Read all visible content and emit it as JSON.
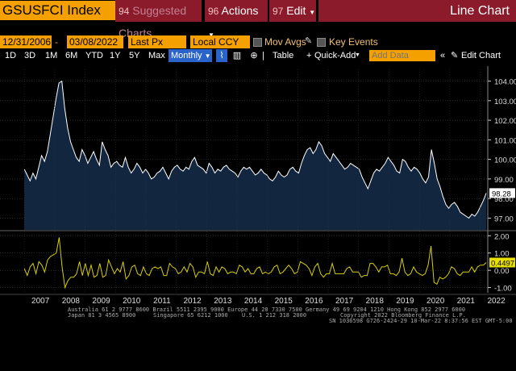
{
  "header": {
    "ticker": "GSUSFCI Index",
    "suggested": {
      "num": "94",
      "label": "Suggested Charts"
    },
    "actions": {
      "num": "96",
      "label": "Actions"
    },
    "edit": {
      "num": "97",
      "label": "Edit"
    },
    "chart_type": "Line Chart"
  },
  "settings": {
    "start_date": "12/31/2006",
    "end_date": "03/08/2022",
    "price_field": "Last Px",
    "currency": "Local CCY",
    "mov_avgs": "Mov Avgs",
    "key_events": "Key Events"
  },
  "toolbar": {
    "periods": [
      "1D",
      "3D",
      "1M",
      "6M",
      "YTD",
      "1Y",
      "5Y",
      "Max"
    ],
    "frequency": "Monthly",
    "table": "Table",
    "quick_add": "Quick-Add",
    "add_data_placeholder": "Add Data",
    "edit_chart": "Edit Chart"
  },
  "chart_data": [
    {
      "type": "area",
      "series": [
        {
          "name": "GSUSFCI Index",
          "x_start": 2007.0,
          "x_end": 2022.2,
          "values": [
            99.5,
            99.2,
            98.9,
            99.3,
            99.0,
            99.6,
            100.2,
            99.9,
            100.4,
            101.3,
            102.2,
            103.1,
            103.9,
            104.0,
            102.6,
            101.6,
            100.9,
            100.5,
            100.1,
            99.9,
            100.5,
            100.2,
            99.8,
            100.1,
            100.4,
            100.0,
            99.7,
            100.9,
            100.5,
            100.2,
            99.6,
            99.8,
            99.9,
            99.7,
            99.6,
            100.1,
            99.6,
            99.3,
            99.5,
            99.8,
            99.6,
            99.3,
            99.5,
            99.3,
            99.0,
            99.1,
            99.3,
            99.4,
            99.6,
            99.3,
            99.0,
            99.4,
            99.6,
            99.7,
            99.5,
            99.4,
            99.6,
            99.5,
            99.9,
            100.1,
            99.7,
            99.6,
            99.5,
            99.3,
            99.8,
            99.6,
            99.3,
            99.5,
            99.4,
            99.6,
            99.7,
            99.5,
            99.4,
            99.3,
            99.1,
            99.4,
            99.6,
            99.5,
            99.6,
            99.4,
            99.2,
            99.3,
            99.5,
            99.3,
            99.2,
            99.0,
            98.9,
            99.1,
            99.4,
            99.2,
            99.1,
            99.2,
            99.5,
            99.6,
            99.4,
            99.3,
            99.8,
            100.2,
            100.5,
            100.6,
            100.3,
            100.5,
            100.9,
            100.7,
            100.3,
            100.1,
            99.9,
            100.3,
            100.1,
            99.9,
            99.7,
            99.5,
            99.6,
            99.8,
            99.7,
            99.6,
            99.5,
            99.1,
            98.8,
            98.5,
            98.9,
            99.3,
            99.5,
            99.4,
            99.6,
            99.8,
            100.1,
            99.9,
            99.7,
            99.4,
            99.3,
            100.0,
            99.9,
            99.6,
            99.4,
            99.6,
            99.5,
            99.3,
            99.0,
            98.8,
            99.1,
            100.5,
            99.8,
            99.0,
            98.6,
            98.1,
            97.7,
            97.5,
            97.7,
            97.8,
            97.6,
            97.3,
            97.2,
            97.1,
            97.0,
            97.2,
            97.1,
            97.3,
            97.6,
            97.9,
            98.28
          ]
        }
      ],
      "ylim": [
        96.4,
        104.6
      ],
      "y_ticks": [
        "104.00",
        "103.00",
        "102.00",
        "101.00",
        "100.00",
        "99.00",
        "98.00",
        "97.00"
      ],
      "last_value": "98.28"
    },
    {
      "type": "line",
      "series": [
        {
          "name": "GSUSFCI Index change",
          "x_start": 2007.0,
          "x_end": 2022.2,
          "values": [
            0.1,
            -0.3,
            0.2,
            0.4,
            -0.2,
            0.5,
            0.3,
            -0.1,
            0.6,
            0.8,
            0.9,
            1.0,
            1.9,
            0.2,
            -1.0,
            -0.6,
            -0.4,
            -0.4,
            -0.2,
            0.5,
            -0.3,
            0.4,
            -0.3,
            0.3,
            -0.4,
            -0.3,
            0.4,
            -0.4,
            -0.3,
            0.6,
            0.2,
            -0.2,
            0.1,
            -0.1,
            0.5,
            -0.5,
            -0.3,
            0.2,
            0.3,
            -0.2,
            -0.3,
            0.2,
            -0.2,
            -0.3,
            0.1,
            0.2,
            0.1,
            0.2,
            -0.3,
            -0.3,
            0.4,
            0.2,
            0.1,
            -0.2,
            -0.1,
            0.2,
            -0.1,
            0.4,
            0.2,
            -0.4,
            -0.1,
            -0.1,
            -0.2,
            0.5,
            -0.2,
            -0.3,
            0.2,
            -0.1,
            0.2,
            0.1,
            -0.2,
            -0.1,
            -0.1,
            -0.2,
            0.3,
            0.2,
            -0.1,
            0.1,
            -0.2,
            -0.2,
            0.1,
            0.2,
            -0.2,
            -0.1,
            -0.2,
            -0.1,
            0.2,
            0.3,
            -0.2,
            -0.1,
            0.1,
            0.3,
            0.1,
            -0.2,
            -0.1,
            0.5,
            0.4,
            0.3,
            0.1,
            -0.3,
            0.2,
            0.4,
            -0.2,
            -0.4,
            -0.2,
            -0.2,
            0.4,
            -0.2,
            -0.2,
            -0.2,
            -0.2,
            0.1,
            0.2,
            -0.1,
            -0.1,
            -0.1,
            -0.4,
            -0.3,
            -0.3,
            0.4,
            0.4,
            0.2,
            -0.1,
            0.2,
            0.2,
            0.3,
            -0.2,
            -0.2,
            -0.3,
            -0.1,
            0.7,
            -0.1,
            -0.3,
            -0.2,
            0.2,
            -0.1,
            -0.2,
            -0.3,
            -0.2,
            0.3,
            1.4,
            -0.7,
            -0.8,
            -0.4,
            -0.5,
            -0.4,
            -0.2,
            0.2,
            0.1,
            -0.2,
            -0.3,
            -0.1,
            -0.1,
            -0.1,
            0.2,
            -0.1,
            0.2,
            0.3,
            0.3,
            0.4497
          ]
        }
      ],
      "ylim": [
        -1.3,
        2.2
      ],
      "y_ticks": [
        "2.00",
        "1.00",
        "0.00",
        "-1.00"
      ],
      "last_value": "0.4497"
    }
  ],
  "x_axis": {
    "labels": [
      "2007",
      "2008",
      "2009",
      "2010",
      "2011",
      "2012",
      "2013",
      "2014",
      "2015",
      "2016",
      "2017",
      "2018",
      "2019",
      "2020",
      "2021",
      "2022"
    ]
  },
  "footer": {
    "line1": "Australia 61 2 9777 8600 Brazil 5511 2395 9000 Europe 44 20 7330 7500 Germany 49 69 9204 1210 Hong Kong 852 2977 6000",
    "line2a": "Japan 81 3 4565 8900",
    "line2b": "Singapore 65 6212 1000",
    "line2c": "U.S. 1 212 318 2000",
    "line2d": "Copyright 2022 Bloomberg Finance L.P.",
    "line3": "SN 1036598 G726-2424-29 10-Mar-22  8:37:56 EST   GMT-5:00"
  },
  "colors": {
    "accent": "#f4a000",
    "action_red": "#8b1a2b",
    "area_fill": "#12263f",
    "line": "#ffffff",
    "osc": "#d8d000"
  }
}
